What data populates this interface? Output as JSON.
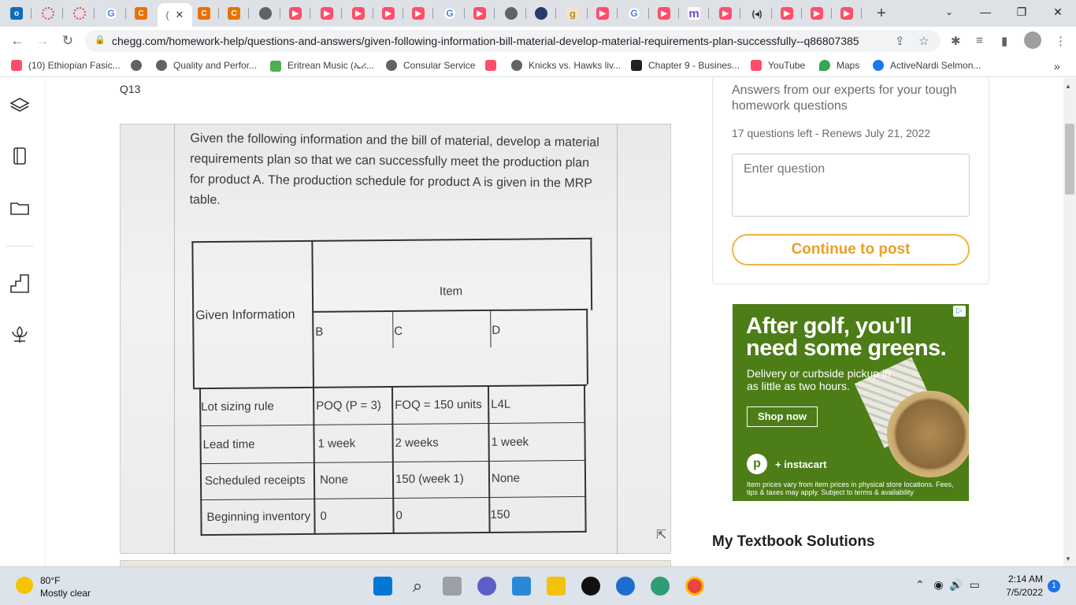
{
  "browser": {
    "url": "chegg.com/homework-help/questions-and-answers/given-following-information-bill-material-develop-material-requirements-plan-successfully--q86807385",
    "active_tab_short": "(",
    "bookmarks": [
      {
        "label": "(10) Ethiopian Fasic...",
        "icon": "youtube-icon",
        "color": "#ff0000"
      },
      {
        "label": "",
        "icon": "globe-icon",
        "color": "#5f6368"
      },
      {
        "label": "Quality and Perfor...",
        "icon": "globe-icon",
        "color": "#5f6368"
      },
      {
        "label": "Eritrean Music (ኤሪ...",
        "icon": "flag-icon",
        "color": "#4caf50"
      },
      {
        "label": "Consular Service",
        "icon": "globe-icon",
        "color": "#5f6368"
      },
      {
        "label": "",
        "icon": "youtube-icon",
        "color": "#ff4e6a"
      },
      {
        "label": "Knicks vs. Hawks liv...",
        "icon": "globe-icon",
        "color": "#5f6368"
      },
      {
        "label": "Chapter 9 - Busines...",
        "icon": "grid-icon",
        "color": "#222222"
      },
      {
        "label": "YouTube",
        "icon": "youtube-icon",
        "color": "#ff4e6a"
      },
      {
        "label": "Maps",
        "icon": "maps-icon",
        "color": "#34a853"
      },
      {
        "label": "ActiveNardi Selmon...",
        "icon": "facebook-icon",
        "color": "#1877f2"
      }
    ]
  },
  "page": {
    "question_number": "Q13",
    "question_text": "Given the following information and the bill of material, develop a material requirements plan so that we can successfully meet the production plan for product A. The production schedule for product A is given in the MRP table.",
    "table": {
      "item_header": "Item",
      "given_header": "Given Information",
      "items": [
        "B",
        "C",
        "D"
      ],
      "rows": [
        {
          "label": "Lot sizing rule",
          "values": [
            "POQ (P = 3)",
            "FOQ = 150 units",
            "L4L"
          ]
        },
        {
          "label": "Lead time",
          "values": [
            "1 week",
            "2 weeks",
            "1 week"
          ]
        },
        {
          "label": "Scheduled receipts",
          "values": [
            "None",
            "150 (week 1)",
            "None"
          ]
        },
        {
          "label": "Beginning inventory",
          "values": [
            "0",
            "0",
            "150"
          ]
        }
      ]
    },
    "sidebar": {
      "heading": "Answers from our experts for your tough homework questions",
      "questions_left": "17 questions left - Renews July 21, 2022",
      "input_placeholder": "Enter question",
      "post_button": "Continue to post",
      "textbook_heading": "My Textbook Solutions"
    },
    "ad": {
      "headline": "After golf, you'll need some greens.",
      "sub": "Delivery or curbside pickup in as little as two hours.",
      "button": "Shop now",
      "brand": "+ instacart",
      "fine": "Item prices vary from item prices in physical store locations. Fees, tips & taxes may apply. Subject to terms & availability",
      "color": "#4d7d17"
    }
  },
  "taskbar": {
    "temperature": "80°F",
    "weather": "Mostly clear",
    "time": "2:14 AM",
    "date": "7/5/2022",
    "notifications": "1"
  }
}
